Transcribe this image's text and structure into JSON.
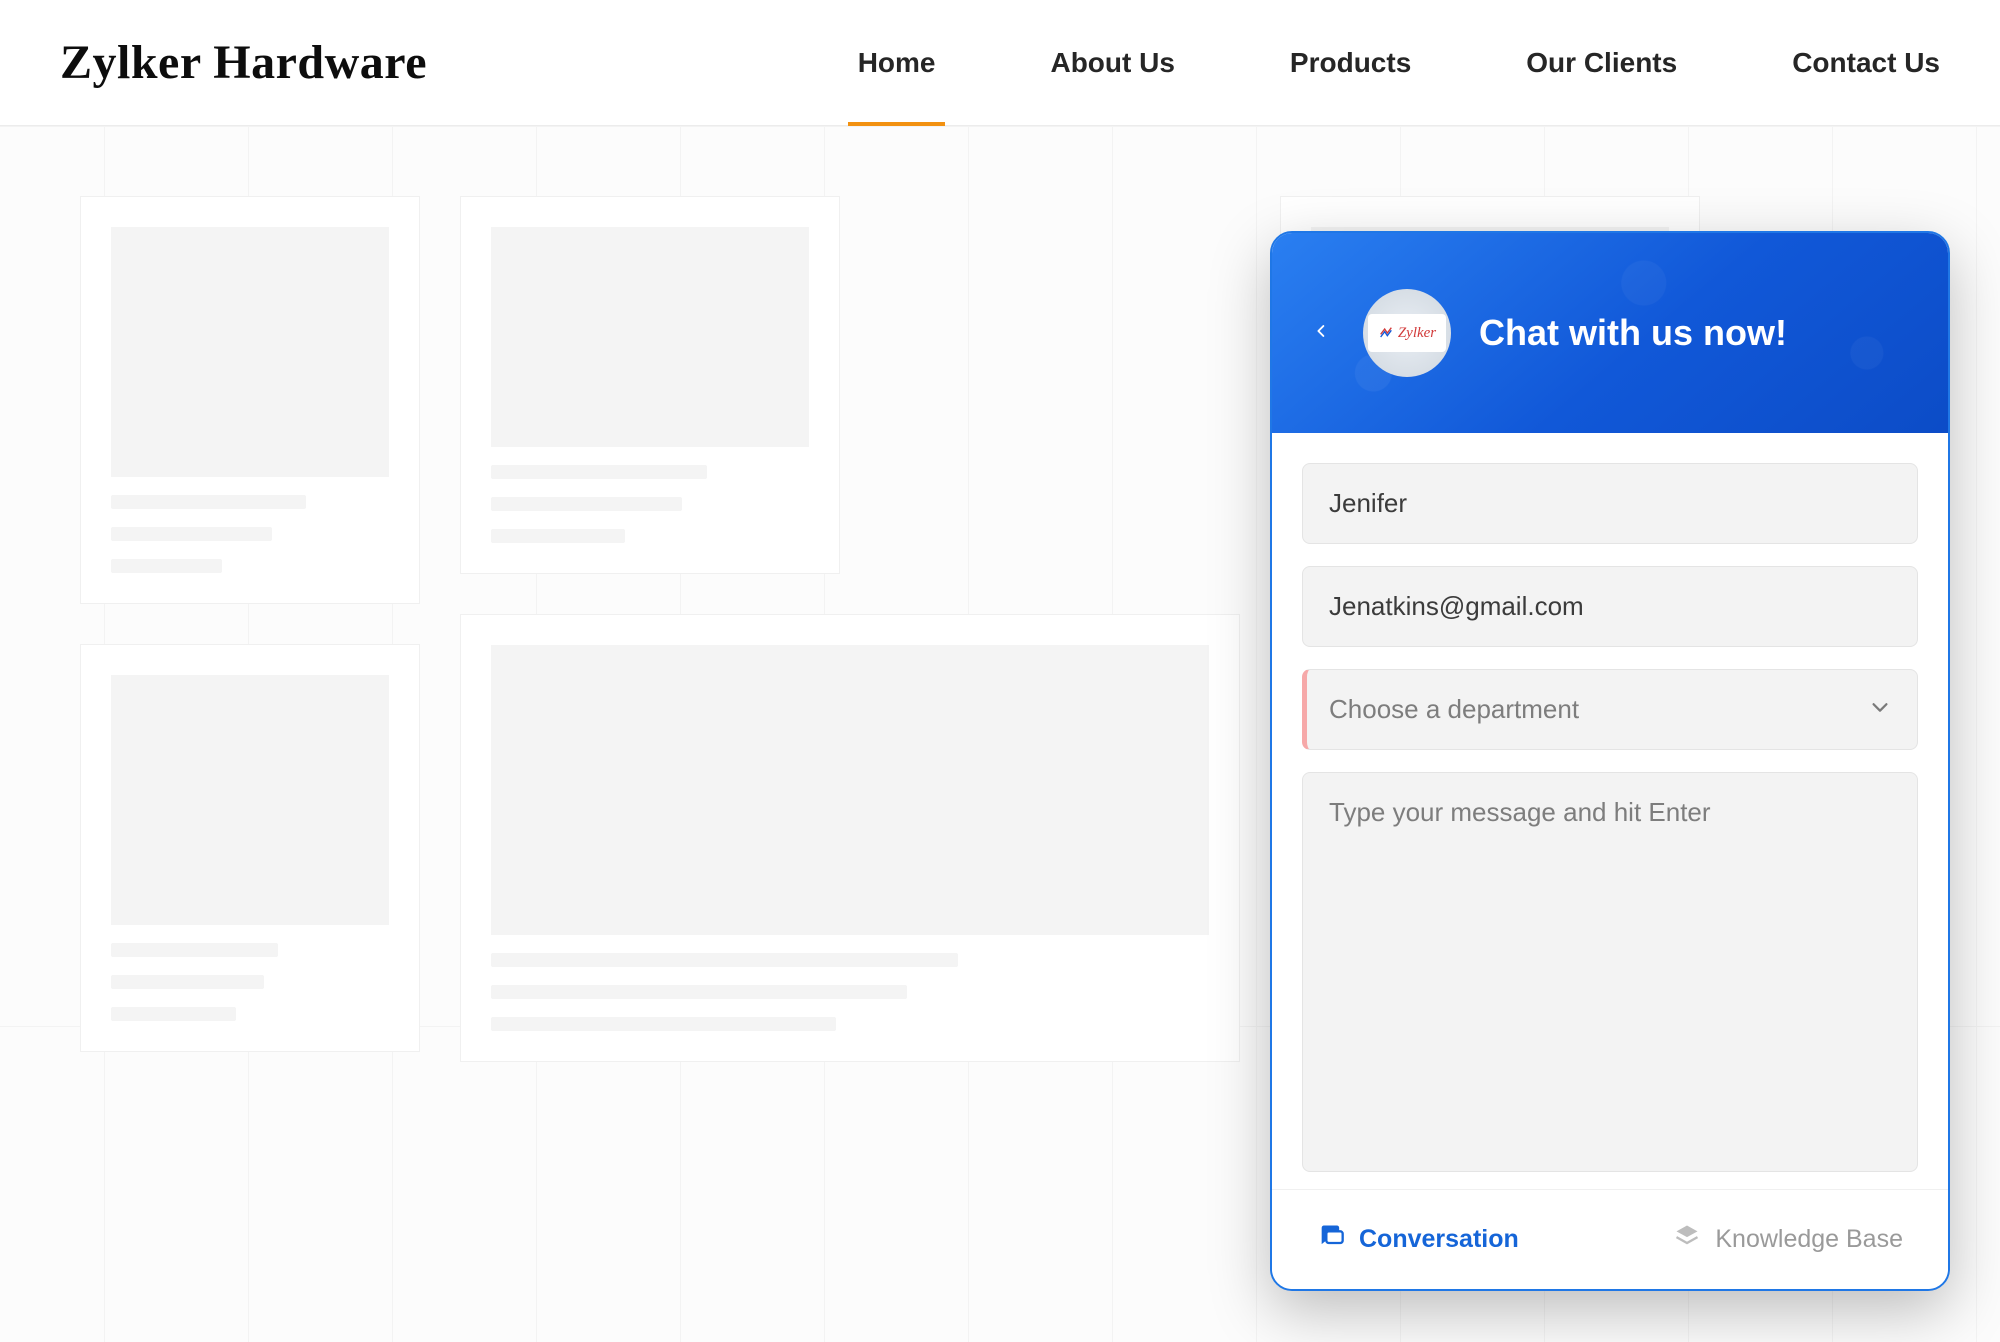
{
  "site": {
    "title": "Zylker Hardware"
  },
  "nav": {
    "items": [
      {
        "label": "Home",
        "active": true
      },
      {
        "label": "About Us",
        "active": false
      },
      {
        "label": "Products",
        "active": false
      },
      {
        "label": "Our Clients",
        "active": false
      },
      {
        "label": "Contact Us",
        "active": false
      }
    ]
  },
  "chat": {
    "header_title": "Chat with us now!",
    "logo_text": "Zylker",
    "fields": {
      "name": {
        "value": "Jenifer"
      },
      "email": {
        "value": "Jenatkins@gmail.com"
      },
      "department": {
        "placeholder": "Choose a department",
        "value": ""
      },
      "message": {
        "placeholder": "Type your message and hit Enter",
        "value": ""
      }
    },
    "tabs": {
      "conversation": {
        "label": "Conversation",
        "active": true
      },
      "knowledge_base": {
        "label": "Knowledge Base",
        "active": false
      }
    },
    "colors": {
      "accent": "#1565d8",
      "header_grad_from": "#2a7ff1",
      "header_grad_to": "#0c4cc7",
      "nav_underline": "#f29111"
    }
  }
}
